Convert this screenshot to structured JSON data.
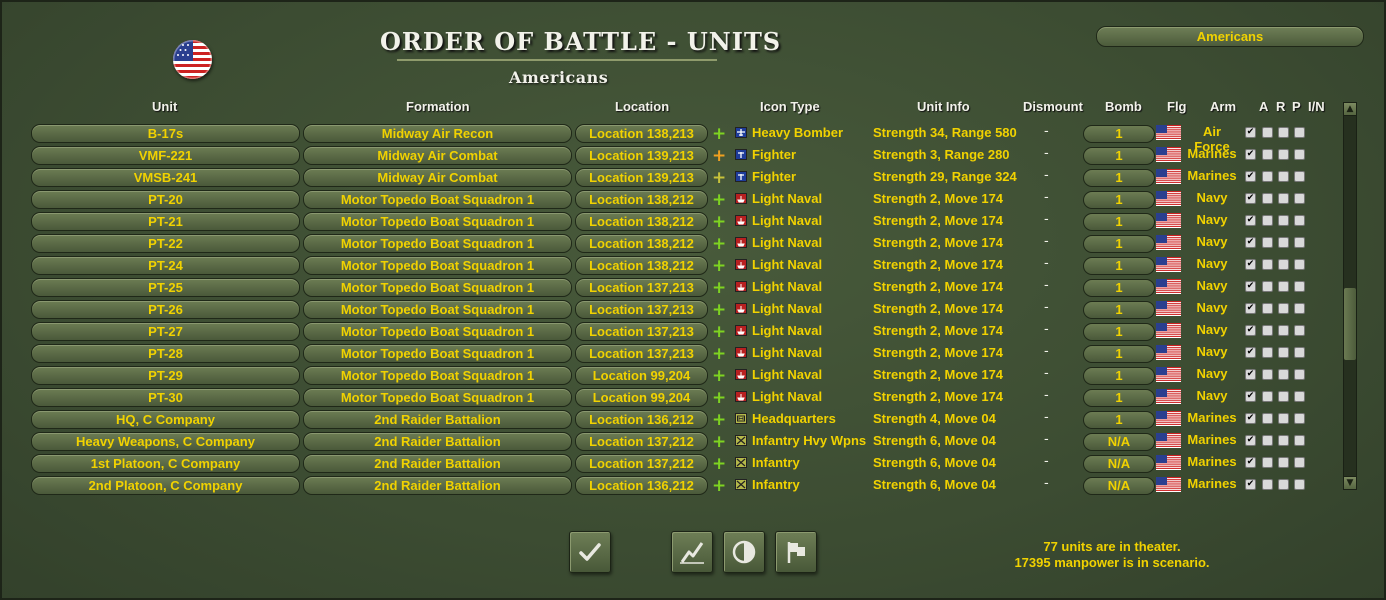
{
  "window": {
    "title": "ORDER OF BATTLE - UNITS",
    "subtitle": "Americans",
    "side_selector": "Americans"
  },
  "columns": {
    "unit": "Unit",
    "formation": "Formation",
    "location": "Location",
    "icon_type": "Icon Type",
    "unit_info": "Unit Info",
    "dismount": "Dismount",
    "bomb": "Bomb",
    "flg": "Flg",
    "arm": "Arm",
    "a": "A",
    "r": "R",
    "p": "P",
    "in": "I/N"
  },
  "rows": [
    {
      "unit": "B-17s",
      "formation": "Midway Air Recon",
      "location": "Location 138,213",
      "icon": "heavy-bomber-icon",
      "icon_color": "blue",
      "plus": "green",
      "icon_type": "Heavy Bomber",
      "info": "Strength 34, Range 580",
      "dismount": "-",
      "bomb": "1",
      "arm": "Air Force",
      "a": true,
      "r": false,
      "p": false,
      "in": false
    },
    {
      "unit": "VMF-221",
      "formation": "Midway Air Combat",
      "location": "Location 139,213",
      "icon": "fighter-icon",
      "icon_color": "blue",
      "plus": "orange",
      "icon_type": "Fighter",
      "info": "Strength 3, Range 280",
      "dismount": "-",
      "bomb": "1",
      "arm": "Marines",
      "a": true,
      "r": false,
      "p": false,
      "in": false
    },
    {
      "unit": "VMSB-241",
      "formation": "Midway Air Combat",
      "location": "Location 139,213",
      "icon": "fighter-icon",
      "icon_color": "blue",
      "plus": "yellow",
      "icon_type": "Fighter",
      "info": "Strength 29, Range 324",
      "dismount": "-",
      "bomb": "1",
      "arm": "Marines",
      "a": true,
      "r": false,
      "p": false,
      "in": false
    },
    {
      "unit": "PT-20",
      "formation": "Motor Topedo Boat Squadron 1",
      "location": "Location 138,212",
      "icon": "light-naval-icon",
      "icon_color": "red",
      "plus": "green",
      "icon_type": "Light Naval",
      "info": "Strength 2, Move 174",
      "dismount": "-",
      "bomb": "1",
      "arm": "Navy",
      "a": true,
      "r": false,
      "p": false,
      "in": false
    },
    {
      "unit": "PT-21",
      "formation": "Motor Topedo Boat Squadron 1",
      "location": "Location 138,212",
      "icon": "light-naval-icon",
      "icon_color": "red",
      "plus": "green",
      "icon_type": "Light Naval",
      "info": "Strength 2, Move 174",
      "dismount": "-",
      "bomb": "1",
      "arm": "Navy",
      "a": true,
      "r": false,
      "p": false,
      "in": false
    },
    {
      "unit": "PT-22",
      "formation": "Motor Topedo Boat Squadron 1",
      "location": "Location 138,212",
      "icon": "light-naval-icon",
      "icon_color": "red",
      "plus": "green",
      "icon_type": "Light Naval",
      "info": "Strength 2, Move 174",
      "dismount": "-",
      "bomb": "1",
      "arm": "Navy",
      "a": true,
      "r": false,
      "p": false,
      "in": false
    },
    {
      "unit": "PT-24",
      "formation": "Motor Topedo Boat Squadron 1",
      "location": "Location 138,212",
      "icon": "light-naval-icon",
      "icon_color": "red",
      "plus": "green",
      "icon_type": "Light Naval",
      "info": "Strength 2, Move 174",
      "dismount": "-",
      "bomb": "1",
      "arm": "Navy",
      "a": true,
      "r": false,
      "p": false,
      "in": false
    },
    {
      "unit": "PT-25",
      "formation": "Motor Topedo Boat Squadron 1",
      "location": "Location 137,213",
      "icon": "light-naval-icon",
      "icon_color": "red",
      "plus": "green",
      "icon_type": "Light Naval",
      "info": "Strength 2, Move 174",
      "dismount": "-",
      "bomb": "1",
      "arm": "Navy",
      "a": true,
      "r": false,
      "p": false,
      "in": false
    },
    {
      "unit": "PT-26",
      "formation": "Motor Topedo Boat Squadron 1",
      "location": "Location 137,213",
      "icon": "light-naval-icon",
      "icon_color": "red",
      "plus": "green",
      "icon_type": "Light Naval",
      "info": "Strength 2, Move 174",
      "dismount": "-",
      "bomb": "1",
      "arm": "Navy",
      "a": true,
      "r": false,
      "p": false,
      "in": false
    },
    {
      "unit": "PT-27",
      "formation": "Motor Topedo Boat Squadron 1",
      "location": "Location 137,213",
      "icon": "light-naval-icon",
      "icon_color": "red",
      "plus": "green",
      "icon_type": "Light Naval",
      "info": "Strength 2, Move 174",
      "dismount": "-",
      "bomb": "1",
      "arm": "Navy",
      "a": true,
      "r": false,
      "p": false,
      "in": false
    },
    {
      "unit": "PT-28",
      "formation": "Motor Topedo Boat Squadron 1",
      "location": "Location 137,213",
      "icon": "light-naval-icon",
      "icon_color": "red",
      "plus": "green",
      "icon_type": "Light Naval",
      "info": "Strength 2, Move 174",
      "dismount": "-",
      "bomb": "1",
      "arm": "Navy",
      "a": true,
      "r": false,
      "p": false,
      "in": false
    },
    {
      "unit": "PT-29",
      "formation": "Motor Topedo Boat Squadron 1",
      "location": "Location 99,204",
      "icon": "light-naval-icon",
      "icon_color": "red",
      "plus": "green",
      "icon_type": "Light Naval",
      "info": "Strength 2, Move 174",
      "dismount": "-",
      "bomb": "1",
      "arm": "Navy",
      "a": true,
      "r": false,
      "p": false,
      "in": false
    },
    {
      "unit": "PT-30",
      "formation": "Motor Topedo Boat Squadron 1",
      "location": "Location 99,204",
      "icon": "light-naval-icon",
      "icon_color": "red",
      "plus": "green",
      "icon_type": "Light Naval",
      "info": "Strength 2, Move 174",
      "dismount": "-",
      "bomb": "1",
      "arm": "Navy",
      "a": true,
      "r": false,
      "p": false,
      "in": false
    },
    {
      "unit": "HQ, C Company",
      "formation": "2nd Raider Battalion",
      "location": "Location 136,212",
      "icon": "headquarters-icon",
      "icon_color": "green",
      "plus": "green",
      "icon_type": "Headquarters",
      "info": "Strength 4, Move 04",
      "dismount": "-",
      "bomb": "1",
      "arm": "Marines",
      "a": true,
      "r": false,
      "p": false,
      "in": false
    },
    {
      "unit": "Heavy Weapons, C Company",
      "formation": "2nd Raider Battalion",
      "location": "Location 137,212",
      "icon": "infantry-icon",
      "icon_color": "green",
      "plus": "green",
      "icon_type": "Infantry Hvy Wpns",
      "info": "Strength 6, Move 04",
      "dismount": "-",
      "bomb": "N/A",
      "arm": "Marines",
      "a": true,
      "r": false,
      "p": false,
      "in": false
    },
    {
      "unit": "1st Platoon, C Company",
      "formation": "2nd Raider Battalion",
      "location": "Location 137,212",
      "icon": "infantry-icon",
      "icon_color": "green",
      "plus": "green",
      "icon_type": "Infantry",
      "info": "Strength 6, Move 04",
      "dismount": "-",
      "bomb": "N/A",
      "arm": "Marines",
      "a": true,
      "r": false,
      "p": false,
      "in": false
    },
    {
      "unit": "2nd Platoon, C Company",
      "formation": "2nd Raider Battalion",
      "location": "Location 136,212",
      "icon": "infantry-icon",
      "icon_color": "green",
      "plus": "green",
      "icon_type": "Infantry",
      "info": "Strength 6, Move 04",
      "dismount": "-",
      "bomb": "N/A",
      "arm": "Marines",
      "a": true,
      "r": false,
      "p": false,
      "in": false
    }
  ],
  "footer": {
    "units_in_theater": "77 units are in theater.",
    "manpower": "17395 manpower is in scenario."
  },
  "buttons": [
    {
      "name": "confirm-button",
      "icon": "checkmark-icon"
    },
    {
      "name": "chart-button",
      "icon": "line-graph-icon"
    },
    {
      "name": "contrast-button",
      "icon": "half-circle-icon"
    },
    {
      "name": "flag-button",
      "icon": "flag-icon"
    }
  ],
  "colors": {
    "text_yellow": "#f1d200",
    "panel_green": "#3c4c32",
    "plus_green": "#7ed321",
    "plus_orange": "#f0a020"
  }
}
